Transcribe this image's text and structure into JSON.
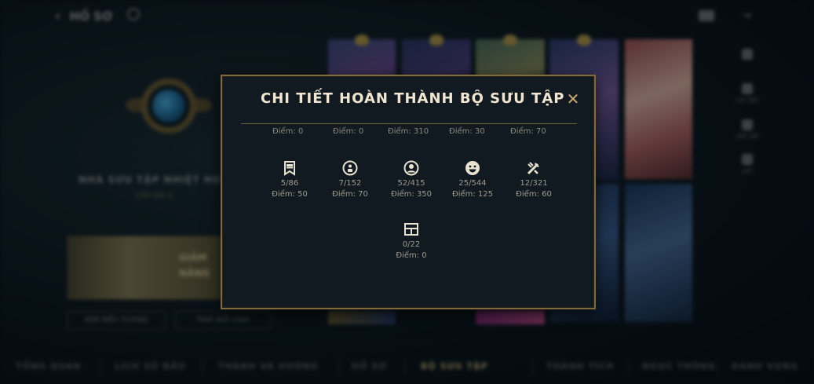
{
  "background": {
    "back_label": "HỒ SƠ",
    "collector_title": "NHÀ SƯU TẬP NHIỆT HUYẾT",
    "collector_sub": "CẤP ĐỘ 2",
    "banner_text_line1": "GIẢM",
    "banner_text_line2": "NĂNG",
    "button1": "XEM BIỂU TƯỢNG",
    "button2": "THAY ĐỔI HÌNH",
    "side_items": [
      "",
      "CHI TIẾT",
      "SẮP XẾP",
      "LỌC"
    ],
    "nav_tabs": [
      "TỔNG QUAN",
      "LỊCH SỬ ĐẤU",
      "THÀNH VÀ HƯỚNG",
      "HỒ SƠ",
      "BỘ SƯU TẬP",
      "THÀNH TÍCH",
      "NGỌC THÔNG",
      "DANH VỌNG"
    ],
    "active_tab_index": 4
  },
  "modal": {
    "title": "CHI TIẾT HOÀN THÀNH BỘ SƯU TẬP",
    "close_icon": "close-icon",
    "top_row": [
      "Điểm: 0",
      "Điểm: 0",
      "Điểm: 310",
      "Điểm: 30",
      "Điểm: 70"
    ],
    "stats": [
      {
        "icon": "banner-icon",
        "progress": "5/86",
        "points": "Điểm: 50"
      },
      {
        "icon": "emote-circle-icon",
        "progress": "7/152",
        "points": "Điểm: 70"
      },
      {
        "icon": "profile-icon-icon",
        "progress": "52/415",
        "points": "Điểm: 350"
      },
      {
        "icon": "smiley-icon",
        "progress": "25/544",
        "points": "Điểm: 125"
      },
      {
        "icon": "ward-skin-icon",
        "progress": "12/321",
        "points": "Điểm: 60"
      },
      {
        "icon": "frame-icon",
        "progress": "0/22",
        "points": "Điểm: 0"
      }
    ]
  },
  "colors": {
    "gold_border": "#7e6a3c",
    "title": "#f0e6d2",
    "icon": "#e8e2d0",
    "text": "#a09b8c",
    "modal_bg": "#111a21"
  }
}
